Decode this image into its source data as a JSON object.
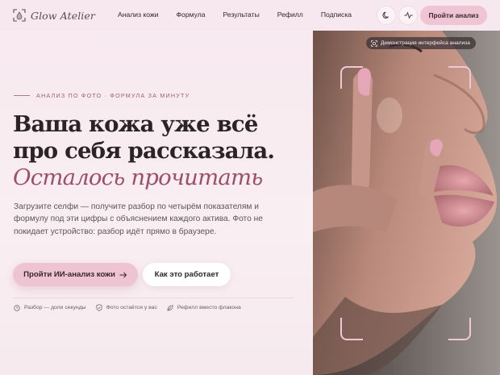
{
  "brand": {
    "name": "Glow Atelier"
  },
  "nav": {
    "items": [
      "Анализ кожи",
      "Формула",
      "Результаты",
      "Рефилл",
      "Подписка"
    ],
    "cta_label": "Пройти анализ"
  },
  "icons": [
    "theme-moon-icon",
    "activity-pulse-icon",
    "arrow-right-icon",
    "clock-icon",
    "shield-icon",
    "leaf-icon",
    "scan-icon"
  ],
  "colors": {
    "accent": "#eec4d2",
    "accent_text": "#9a4f6a",
    "background": "#f7e9ef"
  },
  "hero": {
    "eyebrow": "АНАЛИЗ ПО ФОТО · ФОРМУЛА ЗА МИНУТУ",
    "headline_line1": "Ваша кожа уже всё",
    "headline_line2": "про себя рассказала.",
    "headline_accent": "Осталось прочитать",
    "lead": "Загрузите селфи — получите разбор по четырём показателям и формулу под эти цифры с объяснением каждого актива. Фото не покидает устройство: разбор идёт прямо в браузере.",
    "primary_button": "Пройти ИИ-анализ кожи",
    "secondary_button": "Как это работает"
  },
  "features": [
    {
      "icon": "clock-icon",
      "label": "Разбор — доли секунды"
    },
    {
      "icon": "shield-icon",
      "label": "Фото остаётся у вас"
    },
    {
      "icon": "leaf-icon",
      "label": "Рефилл вместо флакона"
    }
  ],
  "photo": {
    "badge": "Демонстрация интерфейса анализа"
  }
}
